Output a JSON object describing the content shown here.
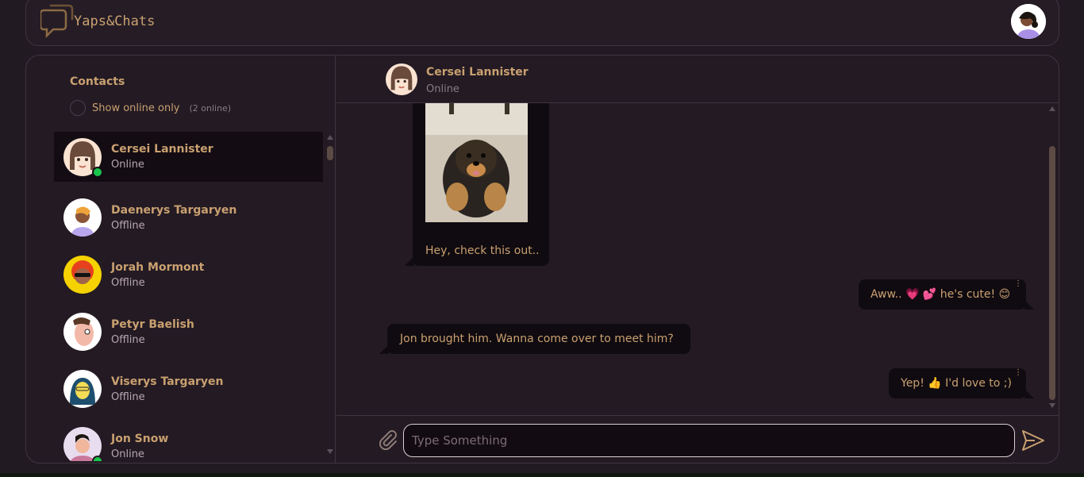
{
  "app": {
    "brand": "Yaps&Chats"
  },
  "sidebar": {
    "title": "Contacts",
    "online_toggle_label": "Show online only",
    "online_count": "(2 online)",
    "contacts": [
      {
        "name": "Cersei Lannister",
        "status": "Online",
        "online": true,
        "active": true
      },
      {
        "name": "Daenerys Targaryen",
        "status": "Offline",
        "online": false
      },
      {
        "name": "Jorah Mormont",
        "status": "Offline",
        "online": false
      },
      {
        "name": "Petyr Baelish",
        "status": "Offline",
        "online": false
      },
      {
        "name": "Viserys Targaryen",
        "status": "Offline",
        "online": false
      },
      {
        "name": "Jon Snow",
        "status": "Online",
        "online": true
      }
    ]
  },
  "chat": {
    "name": "Cersei Lannister",
    "status": "Online",
    "messages": [
      {
        "direction": "in",
        "text": "Hey, check this out..",
        "has_image": true
      },
      {
        "direction": "out",
        "text": "Aww.. 💗 💕  he's cute! 😊"
      },
      {
        "direction": "in",
        "text": "Jon brought him. Wanna come over to meet him?"
      },
      {
        "direction": "out",
        "text": "Yep! 👍  I'd love to ;)"
      }
    ],
    "input_placeholder": "Type Something"
  },
  "colors": {
    "accent": "#c9a070",
    "background": "#221a22",
    "online": "#19c64d",
    "bubble": "#100b10"
  }
}
